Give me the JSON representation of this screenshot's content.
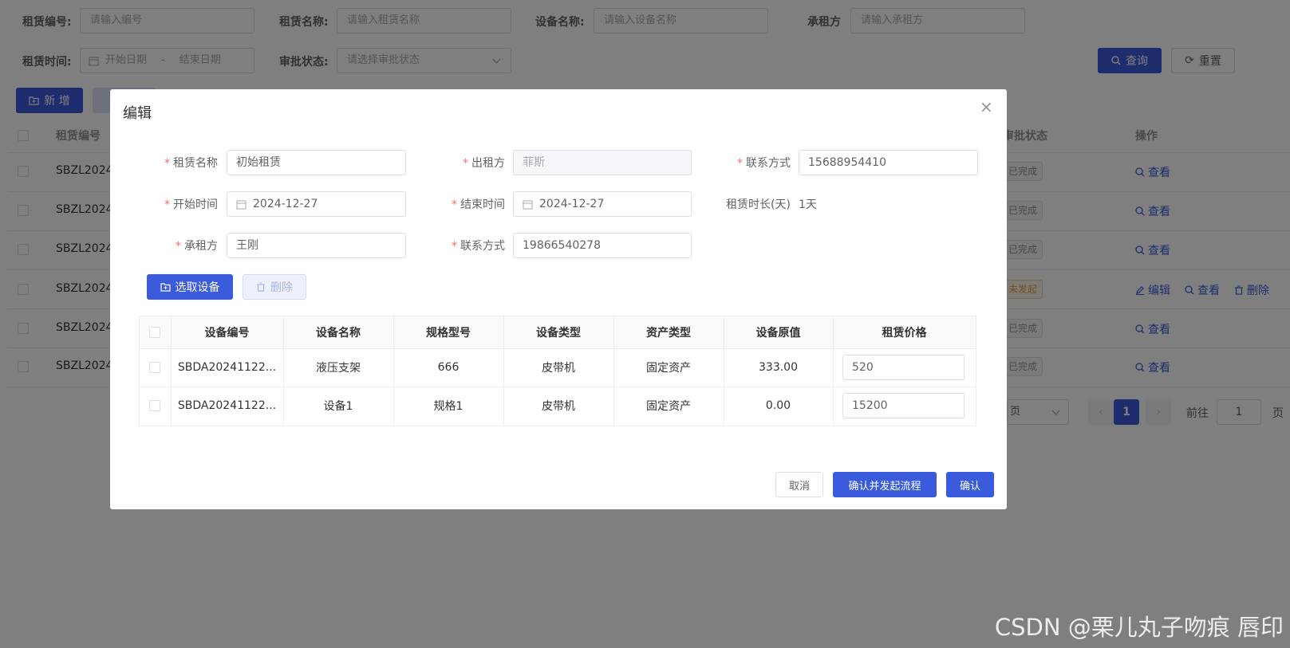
{
  "filters": {
    "code_label": "租赁编号:",
    "code_placeholder": "请输入编号",
    "name_label": "租赁名称:",
    "name_placeholder": "请输入租赁名称",
    "device_label": "设备名称:",
    "device_placeholder": "请输入设备名称",
    "tenant_label": "承租方",
    "tenant_placeholder": "请输入承租方",
    "time_label": "租赁时间:",
    "start_placeholder": "开始日期",
    "date_sep": "-",
    "end_placeholder": "结束日期",
    "status_label": "审批状态:",
    "status_placeholder": "请选择审批状态",
    "query_button": "查询",
    "reset_button": "重置"
  },
  "toolbar": {
    "add_button": "新 增"
  },
  "list": {
    "columns": {
      "code": "租赁编号",
      "status": "审批状态",
      "ops": "操作"
    },
    "rows": [
      {
        "code": "SBZL2024",
        "status": "已完成",
        "ops": [
          "查看"
        ]
      },
      {
        "code": "SBZL2024",
        "status": "已完成",
        "ops": [
          "查看"
        ]
      },
      {
        "code": "SBZL2024",
        "status": "已完成",
        "ops": [
          "查看"
        ]
      },
      {
        "code": "SBZL2024",
        "status": "未发起",
        "ops": [
          "编辑",
          "查看",
          "删除"
        ]
      },
      {
        "code": "SBZL2024",
        "status": "已完成",
        "ops": [
          "查看"
        ]
      },
      {
        "code": "SBZL2024",
        "status": "已完成",
        "ops": [
          "查看"
        ]
      }
    ]
  },
  "pagination": {
    "page_size_suffix": "页",
    "current_page": "1",
    "goto_label": "前往",
    "goto_value": "1",
    "goto_suffix": "页"
  },
  "dialog": {
    "title": "编辑",
    "fields": {
      "lease_name_label": "租赁名称",
      "lease_name": "初始租赁",
      "lessor_label": "出租方",
      "lessor": "菲斯",
      "contact1_label": "联系方式",
      "contact1": "15688954410",
      "start_label": "开始时间",
      "start": "2024-12-27",
      "end_label": "结束时间",
      "end": "2024-12-27",
      "duration_label": "租赁时长(天)",
      "duration": "1天",
      "tenant_label": "承租方",
      "tenant": "王刚",
      "contact2_label": "联系方式",
      "contact2": "19866540278"
    },
    "select_button": "选取设备",
    "delete_button": "删除",
    "table": {
      "headers": [
        "设备编号",
        "设备名称",
        "规格型号",
        "设备类型",
        "资产类型",
        "设备原值",
        "租赁价格"
      ],
      "rows": [
        {
          "code": "SBDA20241122...",
          "name": "液压支架",
          "spec": "666",
          "type": "皮带机",
          "asset": "固定资产",
          "value": "333.00",
          "price": "520"
        },
        {
          "code": "SBDA20241122...",
          "name": "设备1",
          "spec": "规格1",
          "type": "皮带机",
          "asset": "固定资产",
          "value": "0.00",
          "price": "15200"
        }
      ]
    },
    "cancel_button": "取消",
    "confirm_flow_button": "确认并发起流程",
    "confirm_button": "确认"
  },
  "watermark": "CSDN @栗儿丸子吻痕 唇印",
  "colors": {
    "primary": "#3a5bdc",
    "required": "#f56c6c",
    "mask": "rgba(0,0,0,0.5)"
  }
}
